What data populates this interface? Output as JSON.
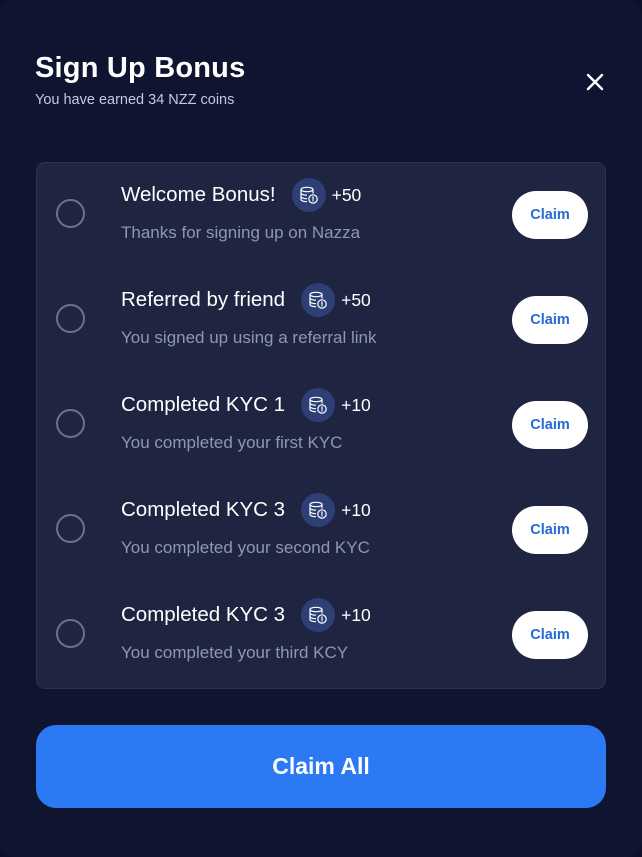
{
  "modal": {
    "title": "Sign Up Bonus",
    "subtitle": "You have earned 34 NZZ coins",
    "close_icon": "close-icon"
  },
  "bonuses": [
    {
      "title": "Welcome Bonus!",
      "points": "+50",
      "description": "Thanks for signing up on Nazza",
      "claim_label": "Claim",
      "icon": "coins-icon"
    },
    {
      "title": "Referred by friend",
      "points": "+50",
      "description": "You signed up using a referral link",
      "claim_label": "Claim",
      "icon": "coins-icon"
    },
    {
      "title": "Completed KYC 1",
      "points": "+10",
      "description": "You completed your first KYC",
      "claim_label": "Claim",
      "icon": "coins-icon"
    },
    {
      "title": "Completed KYC 3",
      "points": "+10",
      "description": "You completed your second KYC",
      "claim_label": "Claim",
      "icon": "coins-icon"
    },
    {
      "title": "Completed KYC 3",
      "points": "+10",
      "description": "You completed your third KCY",
      "claim_label": "Claim",
      "icon": "coins-icon"
    }
  ],
  "footer": {
    "claim_all_label": "Claim All"
  },
  "colors": {
    "background": "#0f1430",
    "card": "#1f2440",
    "accent": "#2b7af4",
    "claim_text": "#2668d6",
    "muted_text": "#8e96b8",
    "coin_badge": "#2e3f76"
  }
}
